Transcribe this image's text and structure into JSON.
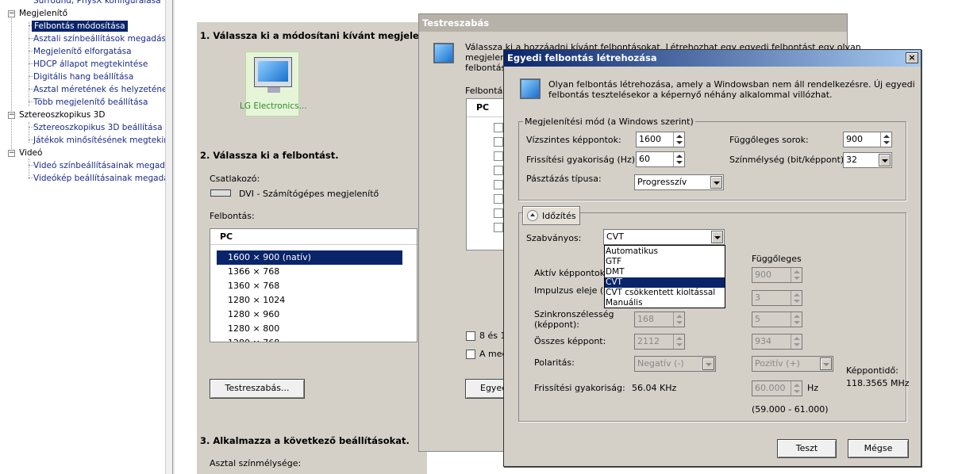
{
  "tree": {
    "items": [
      {
        "label": "Surround, PhysX konfigurálása"
      },
      {
        "label": "Megjelenítő"
      },
      {
        "label": "Felbontás módosítása"
      },
      {
        "label": "Asztali színbeállítások megadása"
      },
      {
        "label": "Megjelenítő elforgatása"
      },
      {
        "label": "HDCP állapot megtekintése"
      },
      {
        "label": "Digitális hang beállítása"
      },
      {
        "label": "Asztal méretének és helyzetének be"
      },
      {
        "label": "Több megjelenítő beállítása"
      },
      {
        "label": "Sztereoszkopikus 3D"
      },
      {
        "label": "Sztereoszkopikus 3D beállítása"
      },
      {
        "label": "Játékok minősítésének megtekintés"
      },
      {
        "label": "Videó"
      },
      {
        "label": "Videó színbeállításainak megadása"
      },
      {
        "label": "Videókép beállításainak megadása"
      }
    ],
    "toggle_minus": "−"
  },
  "main": {
    "step1": "1. Válassza ki a módosítani kívánt megjelenítőt.",
    "monitor_label": "LG Electronics...",
    "step2": "2. Válassza ki a felbontást.",
    "connector_label": "Csatlakozó:",
    "connector_value": "DVI - Számítógépes megjelenítő",
    "resolution_label": "Felbontás:",
    "resolution_header": "PC",
    "resolutions": [
      "1600 × 900 (natív)",
      "1366 × 768",
      "1360 × 768",
      "1280 × 1024",
      "1280 × 960",
      "1280 × 800",
      "1280 × 768"
    ],
    "customize_button": "Testreszabás...",
    "step3": "3. Alkalmazza a következő beállításokat.",
    "color_depth_label": "Asztal színmélysége:"
  },
  "dialog1": {
    "title": "Testreszabás",
    "desc_line1": "Válassza ki a hozzáadni kívánt felbontásokat. Létrehozhat egy egyedi felbontást egy olyan",
    "desc_line2": "megjelenítő",
    "desc_line3": "felbontáso",
    "list_label": "Felbontáso",
    "list_header": "PC",
    "check1": "8 és 16",
    "check2": "A meg",
    "custom_button": "Egyed"
  },
  "dialog2": {
    "title": "Egyedi felbontás létrehozása",
    "close": "×",
    "intro_line1": "Olyan felbontás létrehozása, amely a Windowsban nem áll rendelkezésre. Új egyedi",
    "intro_line2": "felbontás tesztelésekor a képernyő néhány alkalommal villózhat.",
    "mode_group": "Megjelenítési mód (a Windows szerint)",
    "h_pixels_label": "Vízszintes képpontok:",
    "h_pixels": "1600",
    "v_lines_label": "Függőleges sorok:",
    "v_lines": "900",
    "refresh_label": "Frissítési gyakoriság (Hz):",
    "refresh": "60",
    "color_depth_label": "Színmélység (bit/képpont):",
    "color_depth": "32",
    "scan_label": "Pásztázás típusa:",
    "scan": "Progresszív",
    "timing_button": "Időzítés",
    "standard_label": "Szabványos:",
    "standard": "CVT",
    "standard_options": [
      "Automatikus",
      "GTF",
      "DMT",
      "CVT",
      "CVT csökkentett kioltással",
      "Manuális"
    ],
    "standard_selected_index": 3,
    "vertical_col": "Függőleges",
    "active_label": "Aktív képpontok:",
    "active_v": "900",
    "pulse_label": "Impulzus eleje (ke",
    "pulse_v": "3",
    "sync_label1": "Szinkronszélesség",
    "sync_label2": "(képpont):",
    "sync_h": "168",
    "sync_v": "5",
    "total_label": "Összes képpont:",
    "total_h": "2112",
    "total_v": "934",
    "polarity_label": "Polaritás:",
    "polarity_h": "Negatív (-)",
    "polarity_v": "Pozitív (+)",
    "pixel_clock_label": "Képpontidő:",
    "pixel_clock": "118.3565 MHz",
    "freq_label": "Frissítési gyakoriság:",
    "freq_h": "56.04 KHz",
    "freq_v": "60.000",
    "freq_unit": "Hz",
    "freq_range": "(59.000 - 61.000)",
    "test_button": "Teszt",
    "cancel_button": "Mégse"
  },
  "colors": {
    "selection": "#0a246a",
    "dialog_bg": "#d4d0c8",
    "link": "#1a2a8a"
  },
  "icons": [
    "monitor-icon",
    "dvi-connector-icon",
    "display-glyph-icon",
    "collapse-arrow-icon",
    "dropdown-arrow-icon",
    "spin-arrows-icon"
  ]
}
